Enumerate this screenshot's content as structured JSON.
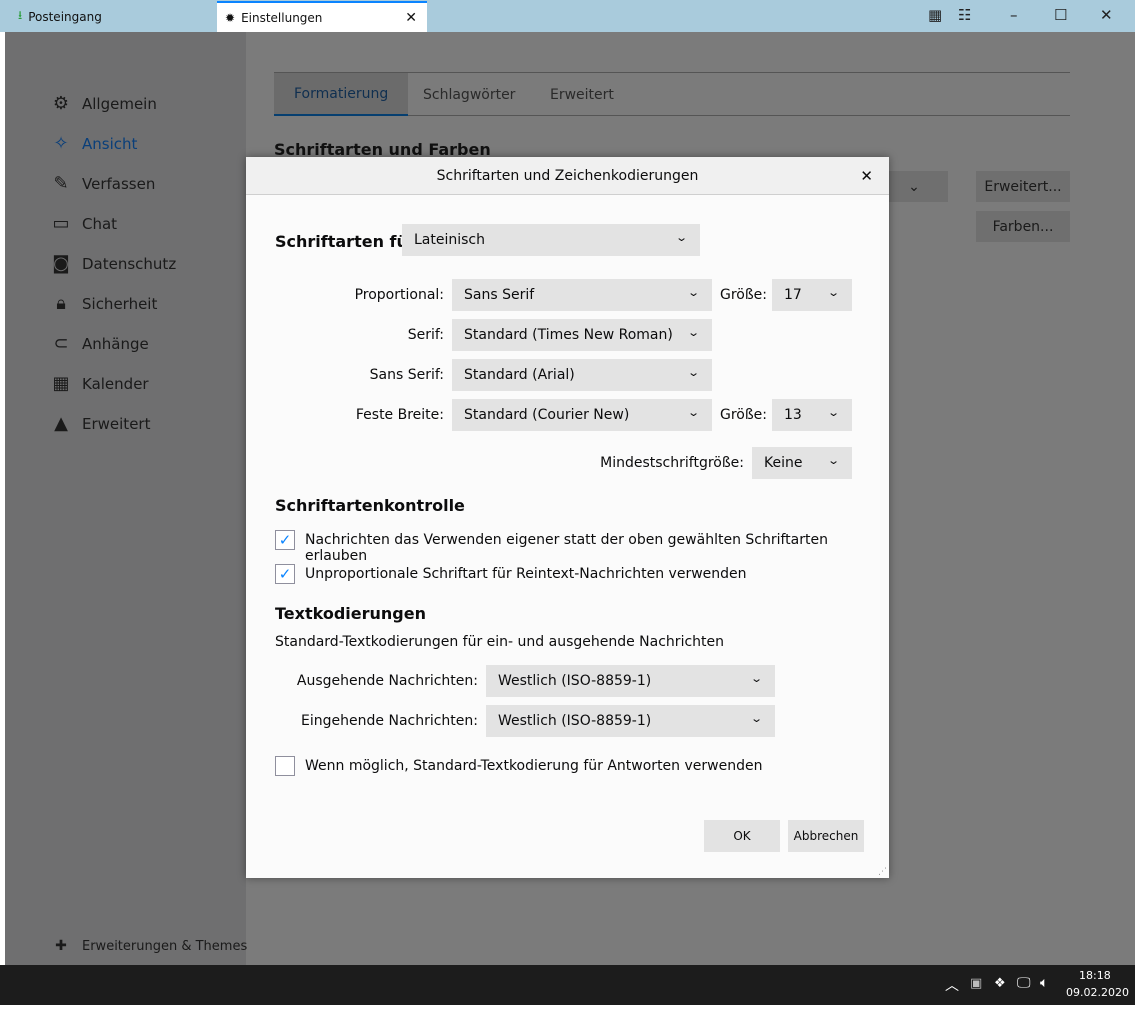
{
  "window": {
    "tabs": [
      {
        "label": "Posteingang",
        "icon": "inbox-icon"
      },
      {
        "label": "Einstellungen",
        "icon": "gear-icon"
      }
    ]
  },
  "sidebar": {
    "items": [
      {
        "label": "Allgemein",
        "icon": "gear-icon"
      },
      {
        "label": "Ansicht",
        "icon": "sparkle-icon"
      },
      {
        "label": "Verfassen",
        "icon": "pencil-icon"
      },
      {
        "label": "Chat",
        "icon": "chat-icon"
      },
      {
        "label": "Datenschutz",
        "icon": "mask-icon"
      },
      {
        "label": "Sicherheit",
        "icon": "lock-icon"
      },
      {
        "label": "Anhänge",
        "icon": "paperclip-icon"
      },
      {
        "label": "Kalender",
        "icon": "calendar-icon"
      },
      {
        "label": "Erweitert",
        "icon": "wizard-hat-icon"
      }
    ],
    "footer": "Erweiterungen & Themes"
  },
  "main": {
    "tabs": [
      "Formatierung",
      "Schlagwörter",
      "Erweitert"
    ],
    "section": "Schriftarten und Farben",
    "advanced_button": "Erweitert...",
    "colors_button": "Farben..."
  },
  "dialog": {
    "title": "Schriftarten und Zeichenkodierungen",
    "fonts_for_label": "Schriftarten für",
    "fonts_for_value": "Lateinisch",
    "proportional_label": "Proportional:",
    "proportional_value": "Sans Serif",
    "size_label": "Größe:",
    "proportional_size": "17",
    "serif_label": "Serif:",
    "serif_value": "Standard (Times New Roman)",
    "sans_label": "Sans Serif:",
    "sans_value": "Standard (Arial)",
    "mono_label": "Feste Breite:",
    "mono_value": "Standard (Courier New)",
    "mono_size": "13",
    "min_size_label": "Mindestschriftgröße:",
    "min_size_value": "Keine",
    "control_heading": "Schriftartenkontrolle",
    "cb1": {
      "label": "Nachrichten das Verwenden eigener statt der oben gewählten Schriftarten erlauben",
      "checked": true
    },
    "cb2": {
      "label": "Unproportionale Schriftart für Reintext-Nachrichten verwenden",
      "checked": true
    },
    "encoding_heading": "Textkodierungen",
    "encoding_desc": "Standard-Textkodierungen für ein- und ausgehende Nachrichten",
    "outgoing_label": "Ausgehende Nachrichten:",
    "outgoing_value": "Westlich (ISO-8859-1)",
    "incoming_label": "Eingehende Nachrichten:",
    "incoming_value": "Westlich (ISO-8859-1)",
    "cb3": {
      "label": "Wenn möglich, Standard-Textkodierung für Antworten verwenden",
      "checked": false
    },
    "ok": "OK",
    "cancel": "Abbrechen"
  },
  "taskbar": {
    "time": "18:18",
    "date": "09.02.2020"
  }
}
